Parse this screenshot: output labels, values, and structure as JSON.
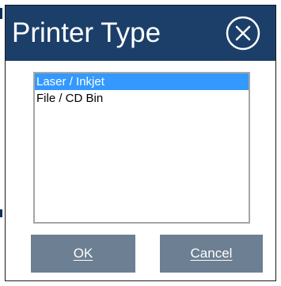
{
  "dialog": {
    "title": "Printer Type",
    "close_icon": "circled-x-icon",
    "list": {
      "items": [
        {
          "label": "Laser / Inkjet",
          "selected": true
        },
        {
          "label": "File / CD Bin",
          "selected": false
        }
      ]
    },
    "buttons": {
      "ok_label": "OK",
      "cancel_label": "Cancel"
    }
  },
  "colors": {
    "titlebar": "#1c3f69",
    "selection": "#3399ff",
    "button": "#6d7f93"
  }
}
